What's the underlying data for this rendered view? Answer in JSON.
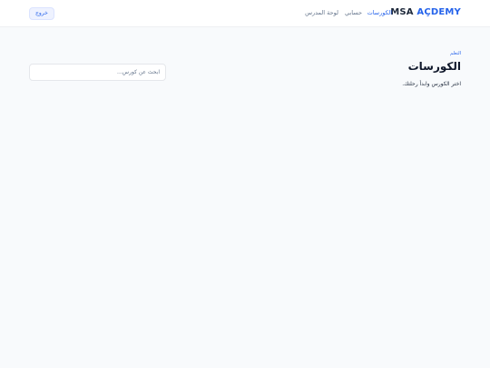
{
  "header": {
    "logo_part1": "MSA",
    "logo_part2": "AÇDEMY",
    "nav": {
      "courses": "الكورسات",
      "account": "حسابي",
      "dashboard": "لوحة المدرس"
    },
    "logout_label": "خروج"
  },
  "main": {
    "breadcrumb": "التعلم",
    "title": "الكورسات",
    "subtitle": "اختر الكورس وابدأ رحلتك.",
    "search_placeholder": "ابحث عن كورس...",
    "search_value": ""
  },
  "colors": {
    "accent": "#2563eb",
    "background": "#f8fafc",
    "text": "#0f172a"
  }
}
